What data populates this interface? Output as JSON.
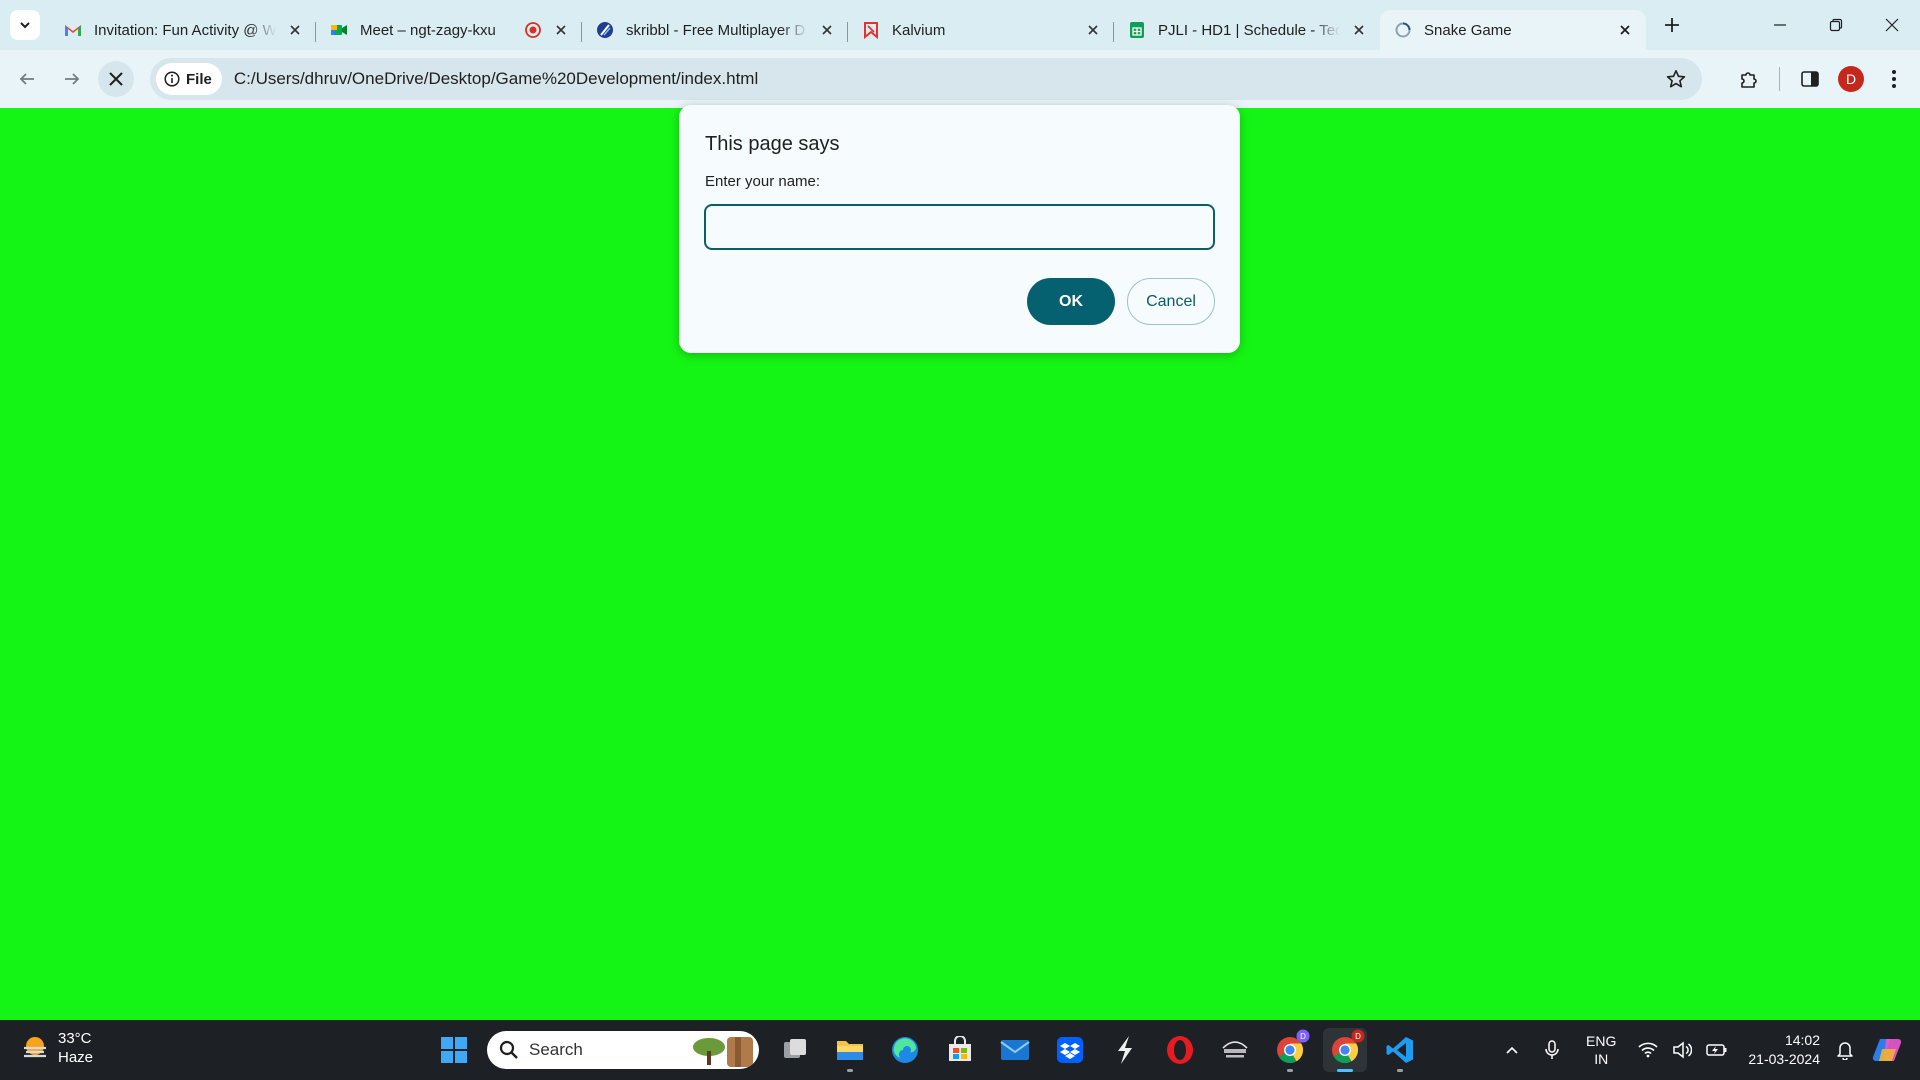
{
  "browser": {
    "tabs": [
      {
        "title": "Invitation: Fun Activity @ W",
        "icon": "gmail-icon",
        "active": false,
        "close": true
      },
      {
        "title": "Meet – ngt-zagy-kxu",
        "icon": "google-meet-icon",
        "active": false,
        "close": true,
        "recording": true
      },
      {
        "title": "skribbl - Free Multiplayer D",
        "icon": "skribbl-icon",
        "active": false,
        "close": true
      },
      {
        "title": "Kalvium",
        "icon": "kalvium-icon",
        "active": false,
        "close": true
      },
      {
        "title": "PJLI - HD1 | Schedule - Tec",
        "icon": "google-sheets-icon",
        "active": false,
        "close": true
      },
      {
        "title": "Snake Game",
        "icon": "loading-icon",
        "active": true,
        "close": true
      }
    ],
    "site_chip": "File",
    "url": "C:/Users/dhruv/OneDrive/Desktop/Game%20Development/index.html",
    "profile_initial": "D"
  },
  "dialog": {
    "title": "This page says",
    "message": "Enter your name:",
    "input_value": "",
    "ok_label": "OK",
    "cancel_label": "Cancel"
  },
  "taskbar": {
    "weather_temp": "33°C",
    "weather_desc": "Haze",
    "search_label": "Search",
    "lang_line1": "ENG",
    "lang_line2": "IN",
    "time": "14:02",
    "date": "21-03-2024"
  },
  "colors": {
    "page_background": "#15f515",
    "accent": "#05606f",
    "taskbar": "#1d2125"
  }
}
